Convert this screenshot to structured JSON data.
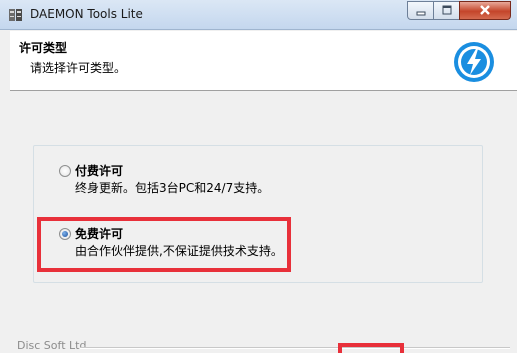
{
  "window": {
    "title": "DAEMON Tools Lite"
  },
  "header": {
    "title": "许可类型",
    "subtitle": "请选择许可类型。"
  },
  "options": [
    {
      "label": "付费许可",
      "description": "终身更新。包括3台PC和24/7支持。",
      "selected": false
    },
    {
      "label": "免费许可",
      "description": "由合作伙伴提供,不保证提供技术支持。",
      "selected": true
    }
  ],
  "footer": {
    "brand": "Disc Soft Ltd"
  },
  "colors": {
    "highlight": "#e8303a",
    "logo": "#1a8ee0"
  }
}
